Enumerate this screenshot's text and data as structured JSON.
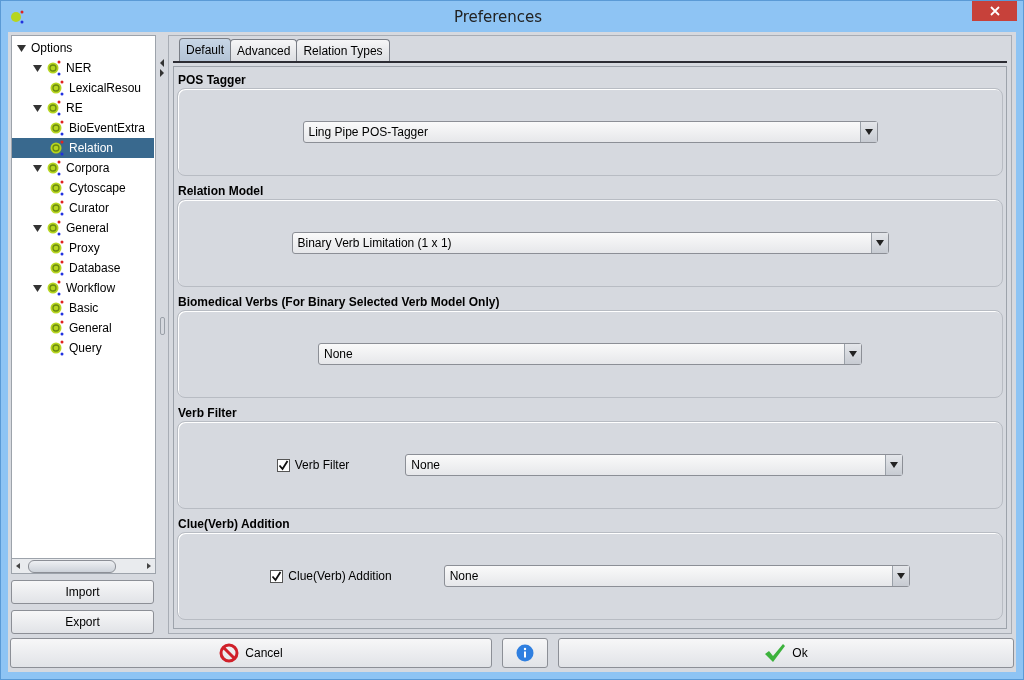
{
  "window": {
    "title": "Preferences"
  },
  "tree": {
    "label": "Options",
    "expanded": true,
    "selected": false,
    "children": [
      {
        "label": "NER",
        "expanded": true,
        "selected": false,
        "children": [
          {
            "label": "LexicalResou",
            "selected": false
          }
        ]
      },
      {
        "label": "RE",
        "expanded": true,
        "selected": false,
        "children": [
          {
            "label": "BioEventExtra",
            "selected": false
          },
          {
            "label": "Relation",
            "selected": true
          }
        ]
      },
      {
        "label": "Corpora",
        "expanded": true,
        "selected": false,
        "children": [
          {
            "label": "Cytoscape",
            "selected": false
          },
          {
            "label": "Curator",
            "selected": false
          }
        ]
      },
      {
        "label": "General",
        "expanded": true,
        "selected": false,
        "children": [
          {
            "label": "Proxy",
            "selected": false
          },
          {
            "label": "Database",
            "selected": false
          }
        ]
      },
      {
        "label": "Workflow",
        "expanded": true,
        "selected": false,
        "children": [
          {
            "label": "Basic",
            "selected": false
          },
          {
            "label": "General",
            "selected": false
          },
          {
            "label": "Query",
            "selected": false
          }
        ]
      }
    ]
  },
  "side_buttons": [
    "Import",
    "Export"
  ],
  "tabs": [
    {
      "label": "Default",
      "selected": true
    },
    {
      "label": "Advanced",
      "selected": false
    },
    {
      "label": "Relation Types",
      "selected": false
    }
  ],
  "sections": [
    {
      "title": "POS Tagger",
      "kind": "dropdown",
      "dropdown": {
        "value": "Ling Pipe POS-Tagger"
      }
    },
    {
      "title": "Relation Model",
      "kind": "dropdown",
      "dropdown": {
        "value": "Binary Verb Limitation (1 x 1)"
      }
    },
    {
      "title": "Biomedical Verbs (For Binary Selected Verb Model Only)",
      "kind": "dropdown",
      "dropdown": {
        "value": "None"
      }
    },
    {
      "title": "Verb Filter",
      "kind": "checkbox-dropdown",
      "checkbox": {
        "label": "Verb Filter",
        "checked": true
      },
      "dropdown": {
        "value": "None"
      }
    },
    {
      "title": "Clue(Verb) Addition",
      "kind": "checkbox-dropdown",
      "checkbox": {
        "label": "Clue(Verb) Addition",
        "checked": true
      },
      "dropdown": {
        "value": "None"
      }
    }
  ],
  "buttons": {
    "cancel": "Cancel",
    "ok": "Ok"
  }
}
